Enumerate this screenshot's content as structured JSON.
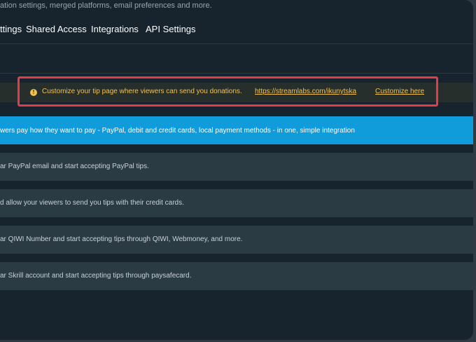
{
  "header": {
    "subtitle": "ation settings, merged platforms, email preferences and more."
  },
  "tabs": [
    {
      "label": "ttings"
    },
    {
      "label": "Shared Access"
    },
    {
      "label": "Integrations"
    },
    {
      "label": "API Settings"
    }
  ],
  "notice": {
    "icon": "info-icon",
    "text": "Customize your tip page where viewers can send you donations.",
    "url": "https://streamlabs.com/ikunytska",
    "action": "Customize here",
    "color": "#f3c14e",
    "highlight_color": "#e43d4a"
  },
  "payment_rows": [
    {
      "text": "wers pay how they want to pay - PayPal, debit and credit cards, local payment methods - in one, simple integration",
      "active": true
    },
    {
      "text": "ar PayPal email and start accepting PayPal tips."
    },
    {
      "text": "d allow your viewers to send you tips with their credit cards."
    },
    {
      "text": "ar QIWI Number and start accepting tips through QIWI, Webmoney, and more."
    },
    {
      "text": "ar Skrill account and start accepting tips through paysafecard."
    }
  ],
  "colors": {
    "background": "#17242d",
    "row": "#2b3b44",
    "active_row": "#109bdb"
  }
}
